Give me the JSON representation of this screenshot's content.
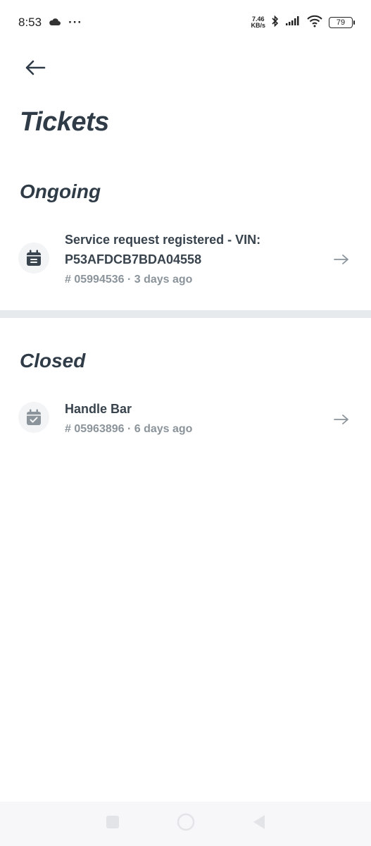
{
  "status_bar": {
    "time": "8:53",
    "cloud_icon": "cloud-icon",
    "more": "···",
    "speed_value": "7.46",
    "speed_unit": "KB/s",
    "battery": "79"
  },
  "header": {
    "back_icon": "arrow-left-icon",
    "title": "Tickets"
  },
  "sections": {
    "ongoing": {
      "title": "Ongoing",
      "tickets": [
        {
          "title": "Service request registered - VIN: P53AFDCB7BDA04558",
          "meta": "# 05994536 · 3 days ago",
          "icon": "calendar-icon"
        }
      ]
    },
    "closed": {
      "title": "Closed",
      "tickets": [
        {
          "title": "Handle Bar",
          "meta": "# 05963896 · 6 days ago",
          "icon": "calendar-check-icon"
        }
      ]
    }
  },
  "colors": {
    "text_primary": "#2f3b46",
    "text_muted": "#8b949b",
    "divider": "#e7eaed"
  }
}
